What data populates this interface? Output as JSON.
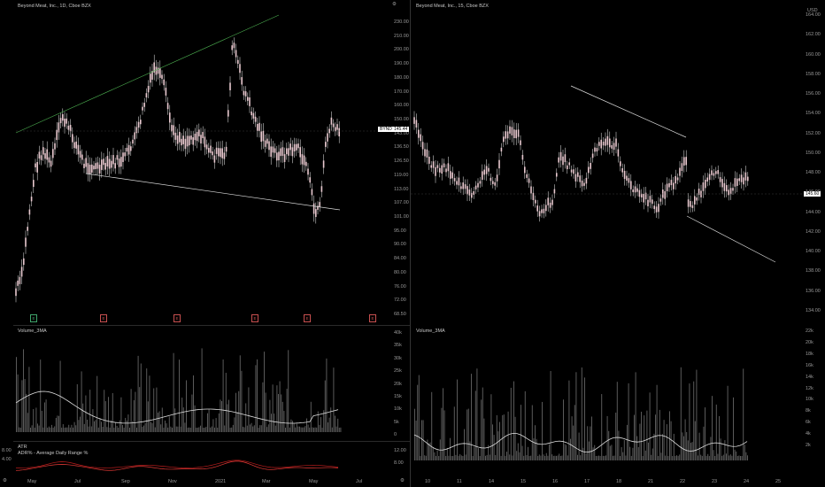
{
  "left": {
    "title": "Beyond Meat, Inc., 1D, Cboe BZX",
    "price_tag": "145.44",
    "ticker_tag": "BYND",
    "price_axis": [
      "230.00",
      "210.00",
      "200.00",
      "190.00",
      "180.00",
      "170.00",
      "160.00",
      "150.00",
      "143.00",
      "136.50",
      "126.50",
      "119.00",
      "113.00",
      "107.00",
      "101.00",
      "95.00",
      "90.00",
      "84.00",
      "80.00",
      "76.00",
      "72.00",
      "68.50"
    ],
    "volume_label": "Volume_3MA",
    "volume_axis": [
      "40k",
      "35k",
      "30k",
      "25k",
      "20k",
      "15k",
      "10k",
      "5k",
      "0"
    ],
    "atr_label": "ATR",
    "adr_label": "ADR% - Average Daily Range %",
    "atr_axis": [
      "8.00",
      "4.00"
    ],
    "x_labels": [
      "May",
      "Jul",
      "Sep",
      "Nov",
      "2021",
      "Mar",
      "May",
      "Jul"
    ]
  },
  "right": {
    "title": "Beyond Meat, Inc., 15, Cboe BZX",
    "currency": "USD",
    "price_tag": "145.60",
    "price_axis": [
      "164.00",
      "162.00",
      "160.00",
      "158.00",
      "156.00",
      "154.00",
      "152.00",
      "150.00",
      "148.00",
      "146.00",
      "144.00",
      "142.00",
      "140.00",
      "138.00",
      "136.00",
      "134.00"
    ],
    "volume_label": "Volume_3MA",
    "volume_axis": [
      "22k",
      "20k",
      "18k",
      "16k",
      "14k",
      "12k",
      "10k",
      "8k",
      "6k",
      "4k",
      "2k"
    ],
    "lower_axis": [
      "12.00",
      "8.00"
    ],
    "x_labels": [
      "10",
      "11",
      "14",
      "15",
      "16",
      "17",
      "18",
      "21",
      "22",
      "23",
      "24",
      "25"
    ]
  },
  "colors": {
    "bg": "#000000",
    "candle": "#e8c9cf",
    "wick": "#f0f0f0",
    "trendline_up": "#4caf50",
    "trendline": "#dddddd",
    "atr": "#b71c1c",
    "adr": "#e53935",
    "ma": "#e0e0e0",
    "volume": "#5a5a5a"
  }
}
